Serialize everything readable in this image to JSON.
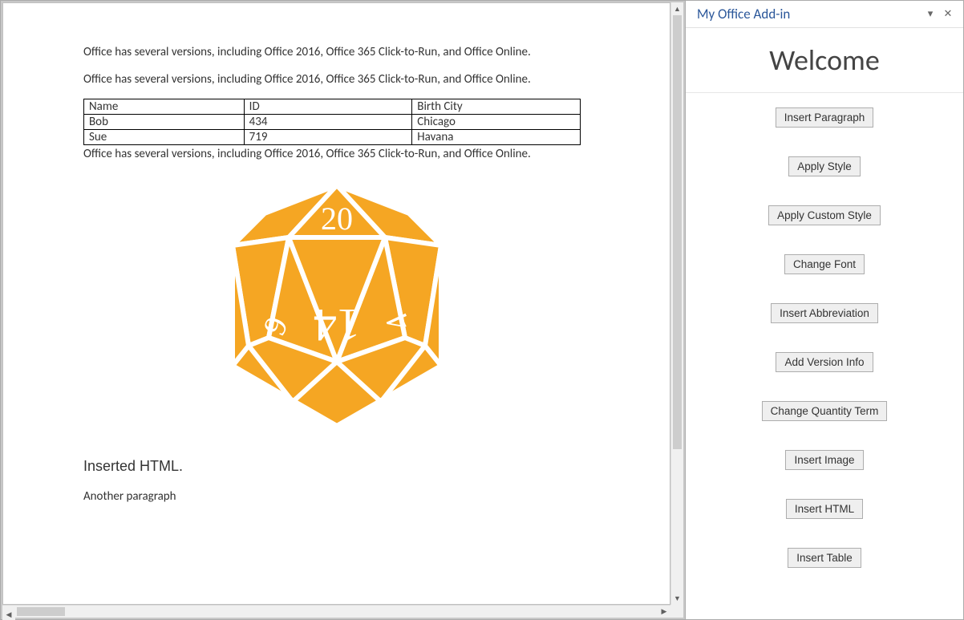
{
  "document": {
    "paragraph": "Office has several versions, including Office 2016, Office 365 Click-to-Run, and Office Online.",
    "table": {
      "headers": [
        "Name",
        "ID",
        "Birth City"
      ],
      "rows": [
        [
          "Bob",
          "434",
          "Chicago"
        ],
        [
          "Sue",
          "719",
          "Havana"
        ]
      ]
    },
    "inserted_html_heading": "Inserted HTML.",
    "another_paragraph": "Another paragraph",
    "dice_image": {
      "name": "d20-dice-icon",
      "top_number": "20",
      "center_number": "14",
      "left_number": "6",
      "right_number": "4",
      "color": "#f5a623"
    }
  },
  "taskpane": {
    "title": "My Office Add-in",
    "heading": "Welcome",
    "buttons": {
      "insert_paragraph": "Insert Paragraph",
      "apply_style": "Apply Style",
      "apply_custom_style": "Apply Custom Style",
      "change_font": "Change Font",
      "insert_abbreviation": "Insert Abbreviation",
      "add_version_info": "Add Version Info",
      "change_quantity_term": "Change Quantity Term",
      "insert_image": "Insert Image",
      "insert_html": "Insert HTML",
      "insert_table": "Insert Table"
    }
  }
}
